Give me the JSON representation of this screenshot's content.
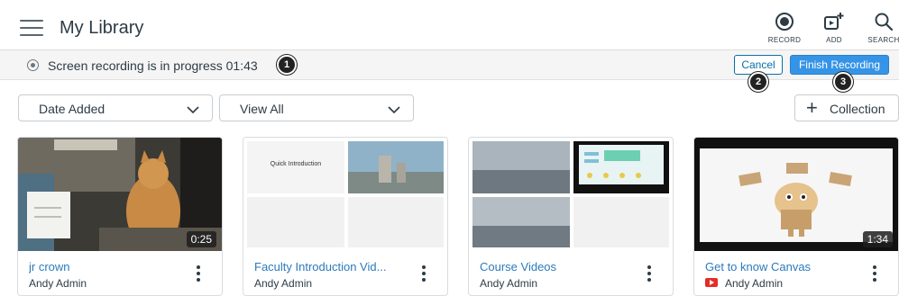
{
  "header": {
    "title": "My Library",
    "actions": [
      {
        "label": "RECORD",
        "icon": "record-icon"
      },
      {
        "label": "ADD",
        "icon": "add-icon"
      },
      {
        "label": "SEARCH",
        "icon": "search-icon"
      }
    ]
  },
  "status": {
    "text": "Screen recording is in progress 01:43",
    "cancel_label": "Cancel",
    "finish_label": "Finish Recording"
  },
  "callouts": [
    "1",
    "2",
    "3"
  ],
  "filters": {
    "sort_value": "Date Added",
    "view_value": "View All",
    "collection_label": "Collection"
  },
  "cards": [
    {
      "title": "jr crown",
      "author": "Andy Admin",
      "duration": "0:25"
    },
    {
      "title": "Faculty Introduction Vid...",
      "author": "Andy Admin",
      "thumb_text": "Quick Introduction"
    },
    {
      "title": "Course Videos",
      "author": "Andy Admin"
    },
    {
      "title": "Get to know Canvas",
      "author": "Andy Admin",
      "duration": "1:34",
      "source_icon": "youtube-icon"
    }
  ],
  "colors": {
    "accent": "#3594e6",
    "link": "#2b7abc",
    "text": "#2d3b45"
  }
}
